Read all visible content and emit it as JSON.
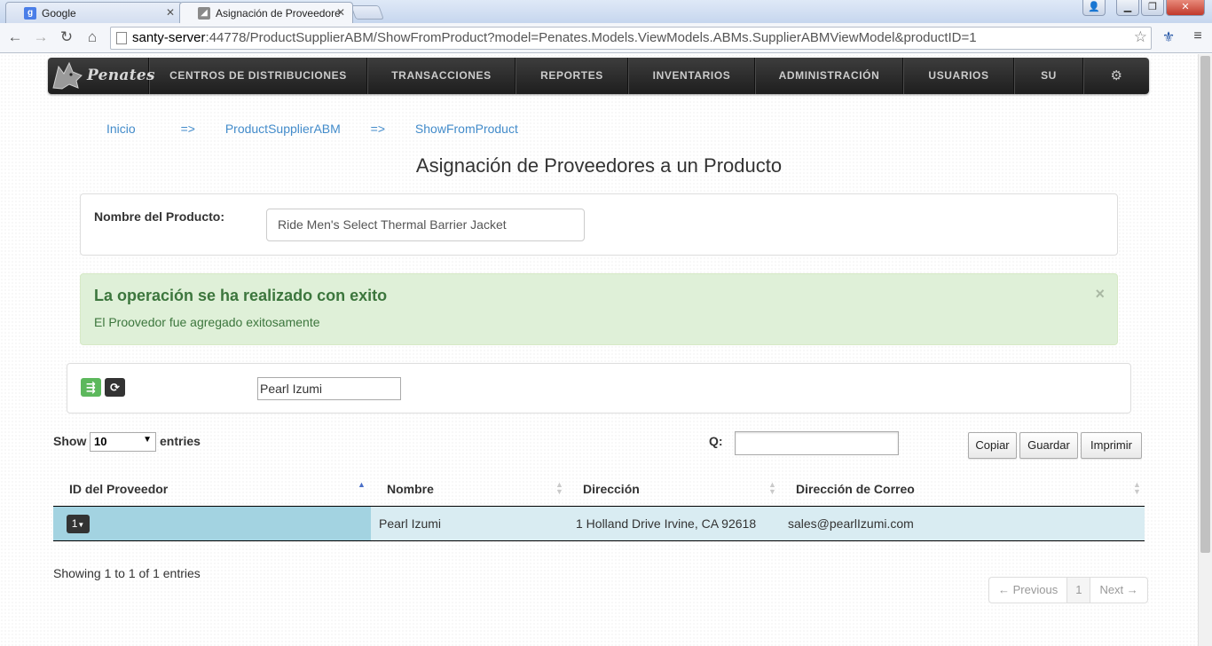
{
  "browser": {
    "tabs": [
      {
        "title": "Google",
        "favicon": "google-favicon-icon",
        "active": false
      },
      {
        "title": "Asignación de Proveedore",
        "favicon": "penates-favicon-icon",
        "active": true
      }
    ],
    "url_host": "santy-server",
    "url_rest": ":44778/ProductSupplierABM/ShowFromProduct?model=Penates.Models.ViewModels.ABMs.SupplierABMViewModel&productID=1"
  },
  "navbar": {
    "brand": "Penates",
    "items": [
      "CENTROS DE DISTRIBUCIONES",
      "TRANSACCIONES",
      "REPORTES",
      "INVENTARIOS",
      "ADMINISTRACIÓN",
      "USUARIOS",
      "SU"
    ],
    "settings_icon": "gear-icon"
  },
  "breadcrumb": {
    "items": [
      "Inicio",
      "ProductSupplierABM",
      "ShowFromProduct"
    ],
    "separator": "=>"
  },
  "page": {
    "title": "Asignación de Proveedores a un Producto"
  },
  "product": {
    "label": "Nombre del Producto:",
    "value": "Ride Men's Select Thermal Barrier Jacket"
  },
  "alert": {
    "title": "La operación se ha realizado con exito",
    "message": "El Proovedor fue agregado exitosamente",
    "close": "×"
  },
  "supplier_filter": {
    "value": "Pearl Izumi"
  },
  "table_controls": {
    "show_label": "Show",
    "page_size": "10",
    "entries_label": "entries",
    "search_label": "Q:",
    "search_value": "",
    "buttons": [
      "Copiar",
      "Guardar",
      "Imprimir"
    ]
  },
  "table": {
    "columns": [
      "ID del Proveedor",
      "Nombre",
      "Dirección",
      "Dirección de Correo"
    ],
    "rows": [
      {
        "id": "1",
        "nombre": "Pearl Izumi",
        "direccion": "1 Holland Drive Irvine, CA 92618",
        "correo": "sales@pearlIzumi.com"
      }
    ]
  },
  "footer": {
    "info": "Showing 1 to 1 of 1 entries",
    "previous": "← Previous",
    "page": "1",
    "next": "Next →"
  },
  "colors": {
    "success_bg": "#dff0d8",
    "success_text": "#3c763d",
    "link": "#428bca",
    "row_highlight": "#d9ecf2",
    "sorted_cell": "#a3d3e1",
    "add_button": "#5cb85c"
  }
}
